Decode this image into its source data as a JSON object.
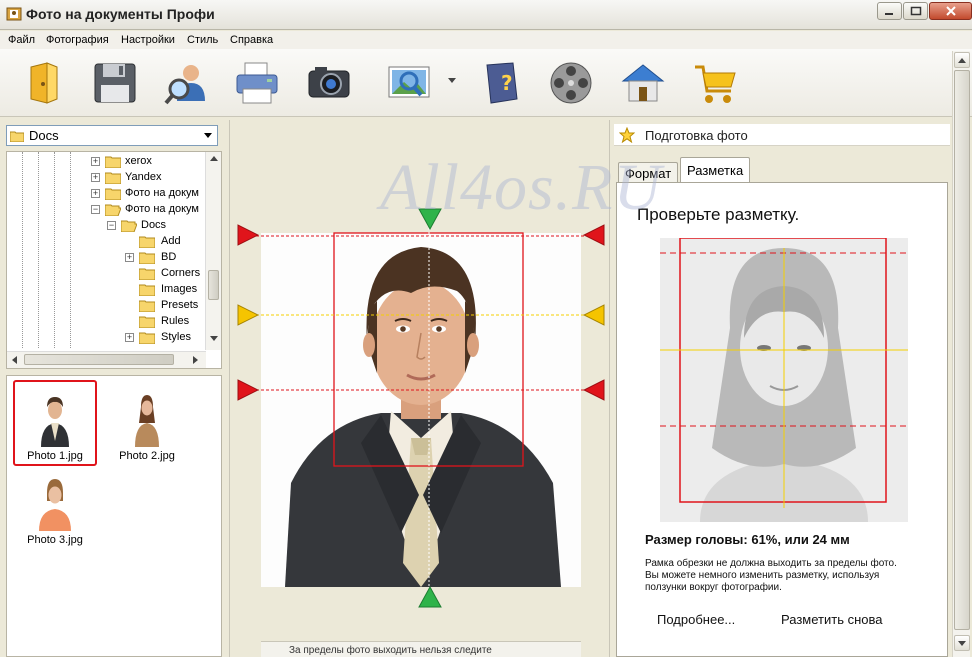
{
  "window": {
    "title": "Фото на документы Профи"
  },
  "menu": {
    "items": [
      "Файл",
      "Фотография",
      "Настройки",
      "Стиль",
      "Справка"
    ]
  },
  "toolbar": {
    "icons": [
      "open-folder-icon",
      "save-icon",
      "user-search-icon",
      "printer-icon",
      "camera-icon",
      "photo-zoom-icon",
      "help-book-icon",
      "film-reel-icon",
      "home-icon",
      "shopping-cart-icon"
    ]
  },
  "folder_picker": {
    "value": "Docs"
  },
  "tree": {
    "items": [
      {
        "label": "xerox",
        "level": 3,
        "expander": "+"
      },
      {
        "label": "Yandex",
        "level": 3,
        "expander": "+"
      },
      {
        "label": "Фото на докум",
        "level": 3,
        "expander": "+"
      },
      {
        "label": "Фото на докум",
        "level": 3,
        "expander": "−"
      },
      {
        "label": "Docs",
        "level": 4,
        "expander": "−"
      },
      {
        "label": "Add",
        "level": 5,
        "expander": ""
      },
      {
        "label": "BD",
        "level": 5,
        "expander": "+"
      },
      {
        "label": "Corners",
        "level": 5,
        "expander": ""
      },
      {
        "label": "Images",
        "level": 5,
        "expander": ""
      },
      {
        "label": "Presets",
        "level": 5,
        "expander": ""
      },
      {
        "label": "Rules",
        "level": 5,
        "expander": ""
      },
      {
        "label": "Styles",
        "level": 5,
        "expander": "+"
      }
    ]
  },
  "thumbnails": [
    {
      "label": "Photo 1.jpg",
      "selected": true
    },
    {
      "label": "Photo 2.jpg",
      "selected": false
    },
    {
      "label": "Photo 3.jpg",
      "selected": false
    }
  ],
  "editor": {
    "bottom_hint": "За пределы фото выходить нельзя следите",
    "watermark": "All4os.RU"
  },
  "right_panel": {
    "header": "Подготовка фото",
    "tabs": [
      {
        "label": "Формат",
        "active": false
      },
      {
        "label": "Разметка",
        "active": true
      }
    ],
    "check_title": "Проверьте разметку.",
    "head_size": "Размер головы: 61%, или 24 мм",
    "note_lines": [
      "Рамка обрезки не должна выходить за пределы фото.",
      "Вы можете немного изменить разметку,  используя",
      "ползунки вокруг фотографии."
    ],
    "link_more": "Подробнее...",
    "link_redo": "Разметить снова"
  },
  "colors": {
    "guide_red": "#e0141b",
    "guide_yellow": "#f5d000",
    "handle_green": "#2fb34a",
    "window_bg": "#ece9d8"
  }
}
